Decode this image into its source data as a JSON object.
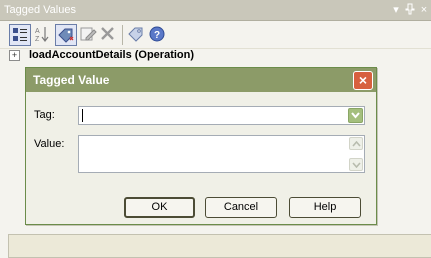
{
  "panel": {
    "title": "Tagged Values",
    "controls": {
      "dropdown_glyph": "▾",
      "pin_glyph": "ᵾ",
      "close_glyph": "×"
    }
  },
  "toolbar": {
    "buttons": [
      {
        "icon": "categorized-view-icon"
      },
      {
        "icon": "sort-alpha-icon"
      },
      {
        "icon": "new-tag-icon"
      },
      {
        "icon": "edit-tag-icon"
      },
      {
        "icon": "delete-tag-icon"
      },
      {
        "icon": "tag-info-icon"
      },
      {
        "icon": "help-icon"
      }
    ]
  },
  "tree": {
    "expander": "+",
    "item_label": "loadAccountDetails (Operation)"
  },
  "dialog": {
    "title": "Tagged Value",
    "close_glyph": "×",
    "tag_label": "Tag:",
    "tag_value": "",
    "value_label": "Value:",
    "value_text": "",
    "ok_label": "OK",
    "cancel_label": "Cancel",
    "help_label": "Help"
  },
  "colors": {
    "dialog_title": "#8c9b68",
    "close_button": "#d7603e",
    "accent_green": "#a4bf7d"
  }
}
